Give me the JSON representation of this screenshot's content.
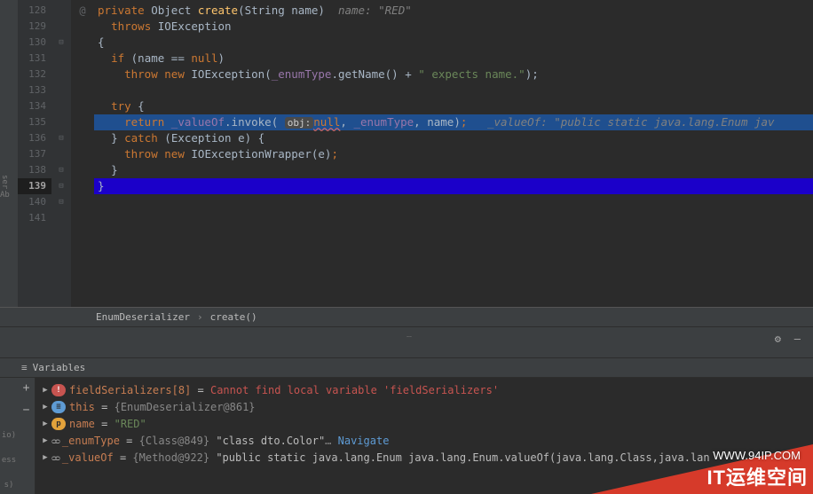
{
  "gutter": {
    "lines": [
      "128",
      "129",
      "130",
      "131",
      "132",
      "133",
      "134",
      "135",
      "136",
      "137",
      "138",
      "139",
      "140",
      "141"
    ],
    "current": "139",
    "override_marker": "@"
  },
  "left_labels": {
    "l1": "ser",
    "l2": "Ab"
  },
  "code": {
    "l128": {
      "kw1": "private",
      "typ": "Object",
      "mtd": "create",
      "sig": "(String name)",
      "hint": "name: \"RED\""
    },
    "l129": {
      "kw": "throws",
      "exc": "IOException"
    },
    "l130": {
      "b": "{"
    },
    "l131": {
      "kw": "if",
      "cond": "(name ==",
      "kw2": "null",
      "close": ")"
    },
    "l132": {
      "kw": "throw",
      "kw2": "new",
      "cls": "IOException",
      "open": "(",
      "fld": "_enumType",
      "call": ".getName() +",
      "str": "\" expects name.\"",
      "close": ");"
    },
    "l134": {
      "kw": "try",
      "b": "{"
    },
    "l135": {
      "kw": "return",
      "fld": "_valueOf",
      "call": ".invoke(",
      "pill": "obj:",
      "nul": "null",
      "c1": ",",
      "fld2": "_enumType",
      "c2": ",",
      "arg": "name",
      "close": ")",
      "sc": ";",
      "hint": "_valueOf: \"public static java.lang.Enum jav"
    },
    "l136": {
      "b": "}",
      "kw": "catch",
      "cond": "(Exception e) {"
    },
    "l137": {
      "kw": "throw",
      "kw2": "new",
      "cls": "IOExceptionWrapper",
      "args": "(e)",
      "sc": ";"
    },
    "l138": {
      "b": "}"
    },
    "l139": {
      "b": "}"
    },
    "l140": {
      "b": "}"
    }
  },
  "breadcrumb": {
    "item1": "EnumDeserializer",
    "item2": "create()"
  },
  "variables_panel": {
    "title": "Variables",
    "rows": {
      "r0": {
        "name": "fieldSerializers[8]",
        "eq": " = ",
        "val": "Cannot find local variable 'fieldSerializers'"
      },
      "r1": {
        "name": "this",
        "eq": " = ",
        "val": "{EnumDeserializer@861}"
      },
      "r2": {
        "name": "name",
        "eq": " = ",
        "val": "\"RED\""
      },
      "r3": {
        "name": "_enumType",
        "eq": " = ",
        "val1": "{Class@849}",
        "val2": " \"class dto.Color\"",
        "dots": "… ",
        "link": "Navigate"
      },
      "r4": {
        "name": "_valueOf",
        "eq": " = ",
        "val1": "{Method@922}",
        "val2": " \"public static java.lang.Enum java.lang.Enum.valueOf(java.lang.Class,java.lan"
      }
    }
  },
  "dbg_left": {
    "a": "io)",
    "b": "ess",
    "c": "s)"
  },
  "watermark": {
    "url": "WWW.94IP.COM",
    "text": "IT运维空间"
  }
}
